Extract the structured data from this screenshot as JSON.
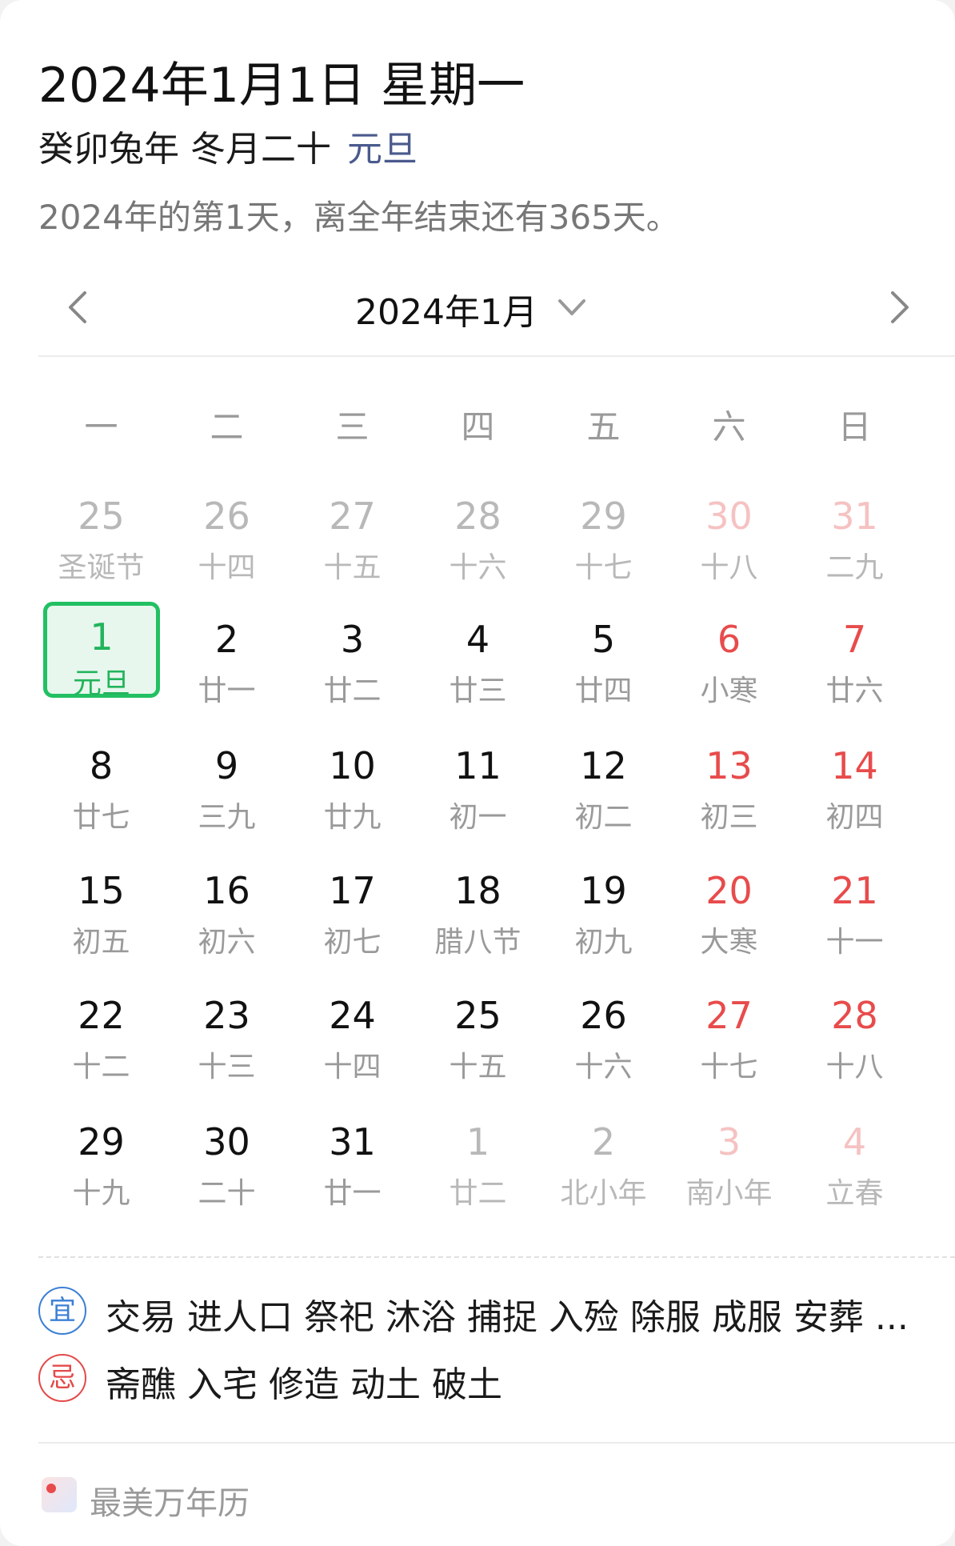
{
  "header": {
    "date": "2024年1月1日 星期一",
    "lunar": "癸卯兔年 冬月二十",
    "festival": "元旦",
    "info": "2024年的第1天，离全年结束还有365天。"
  },
  "nav": {
    "month_label": "2024年1月",
    "prev_icon": "chevron-left-icon",
    "next_icon": "chevron-right-icon",
    "dropdown_icon": "chevron-down-icon"
  },
  "weekdays": [
    "一",
    "二",
    "三",
    "四",
    "五",
    "六",
    "日"
  ],
  "calendar": {
    "rows": [
      [
        {
          "day": "25",
          "lunar": "圣诞节",
          "out": true
        },
        {
          "day": "26",
          "lunar": "十四",
          "out": true
        },
        {
          "day": "27",
          "lunar": "十五",
          "out": true
        },
        {
          "day": "28",
          "lunar": "十六",
          "out": true
        },
        {
          "day": "29",
          "lunar": "十七",
          "out": true
        },
        {
          "day": "30",
          "lunar": "十八",
          "out": true
        },
        {
          "day": "31",
          "lunar": "二九",
          "out": true
        }
      ],
      [
        {
          "day": "1",
          "lunar": "元旦",
          "selected": true
        },
        {
          "day": "2",
          "lunar": "廿一"
        },
        {
          "day": "3",
          "lunar": "廿二"
        },
        {
          "day": "4",
          "lunar": "廿三"
        },
        {
          "day": "5",
          "lunar": "廿四"
        },
        {
          "day": "6",
          "lunar": "小寒"
        },
        {
          "day": "7",
          "lunar": "廿六"
        }
      ],
      [
        {
          "day": "8",
          "lunar": "廿七"
        },
        {
          "day": "9",
          "lunar": "三九"
        },
        {
          "day": "10",
          "lunar": "廿九"
        },
        {
          "day": "11",
          "lunar": "初一"
        },
        {
          "day": "12",
          "lunar": "初二"
        },
        {
          "day": "13",
          "lunar": "初三"
        },
        {
          "day": "14",
          "lunar": "初四"
        }
      ],
      [
        {
          "day": "15",
          "lunar": "初五"
        },
        {
          "day": "16",
          "lunar": "初六"
        },
        {
          "day": "17",
          "lunar": "初七"
        },
        {
          "day": "18",
          "lunar": "腊八节"
        },
        {
          "day": "19",
          "lunar": "初九"
        },
        {
          "day": "20",
          "lunar": "大寒"
        },
        {
          "day": "21",
          "lunar": "十一"
        }
      ],
      [
        {
          "day": "22",
          "lunar": "十二"
        },
        {
          "day": "23",
          "lunar": "十三"
        },
        {
          "day": "24",
          "lunar": "十四"
        },
        {
          "day": "25",
          "lunar": "十五"
        },
        {
          "day": "26",
          "lunar": "十六"
        },
        {
          "day": "27",
          "lunar": "十七"
        },
        {
          "day": "28",
          "lunar": "十八"
        }
      ],
      [
        {
          "day": "29",
          "lunar": "十九"
        },
        {
          "day": "30",
          "lunar": "二十"
        },
        {
          "day": "31",
          "lunar": "廿一"
        },
        {
          "day": "1",
          "lunar": "廿二",
          "out": true
        },
        {
          "day": "2",
          "lunar": "北小年",
          "out": true
        },
        {
          "day": "3",
          "lunar": "南小年",
          "out": true
        },
        {
          "day": "4",
          "lunar": "立春",
          "out": true
        }
      ]
    ]
  },
  "yiji": {
    "yi_label": "宜",
    "yi_text": "交易 进人口 祭祀 沐浴 捕捉 入殓 除服 成服 安葬 ...",
    "ji_label": "忌",
    "ji_text": "斋醮 入宅 修造 动土 破土"
  },
  "footer": {
    "brand": "最美万年历"
  },
  "colors": {
    "selected_green": "#22c062",
    "weekend_red": "#e84b4b",
    "festival_blue": "#4a5a8c",
    "yi_blue": "#3b7fd4",
    "ji_red": "#e34a4a"
  }
}
